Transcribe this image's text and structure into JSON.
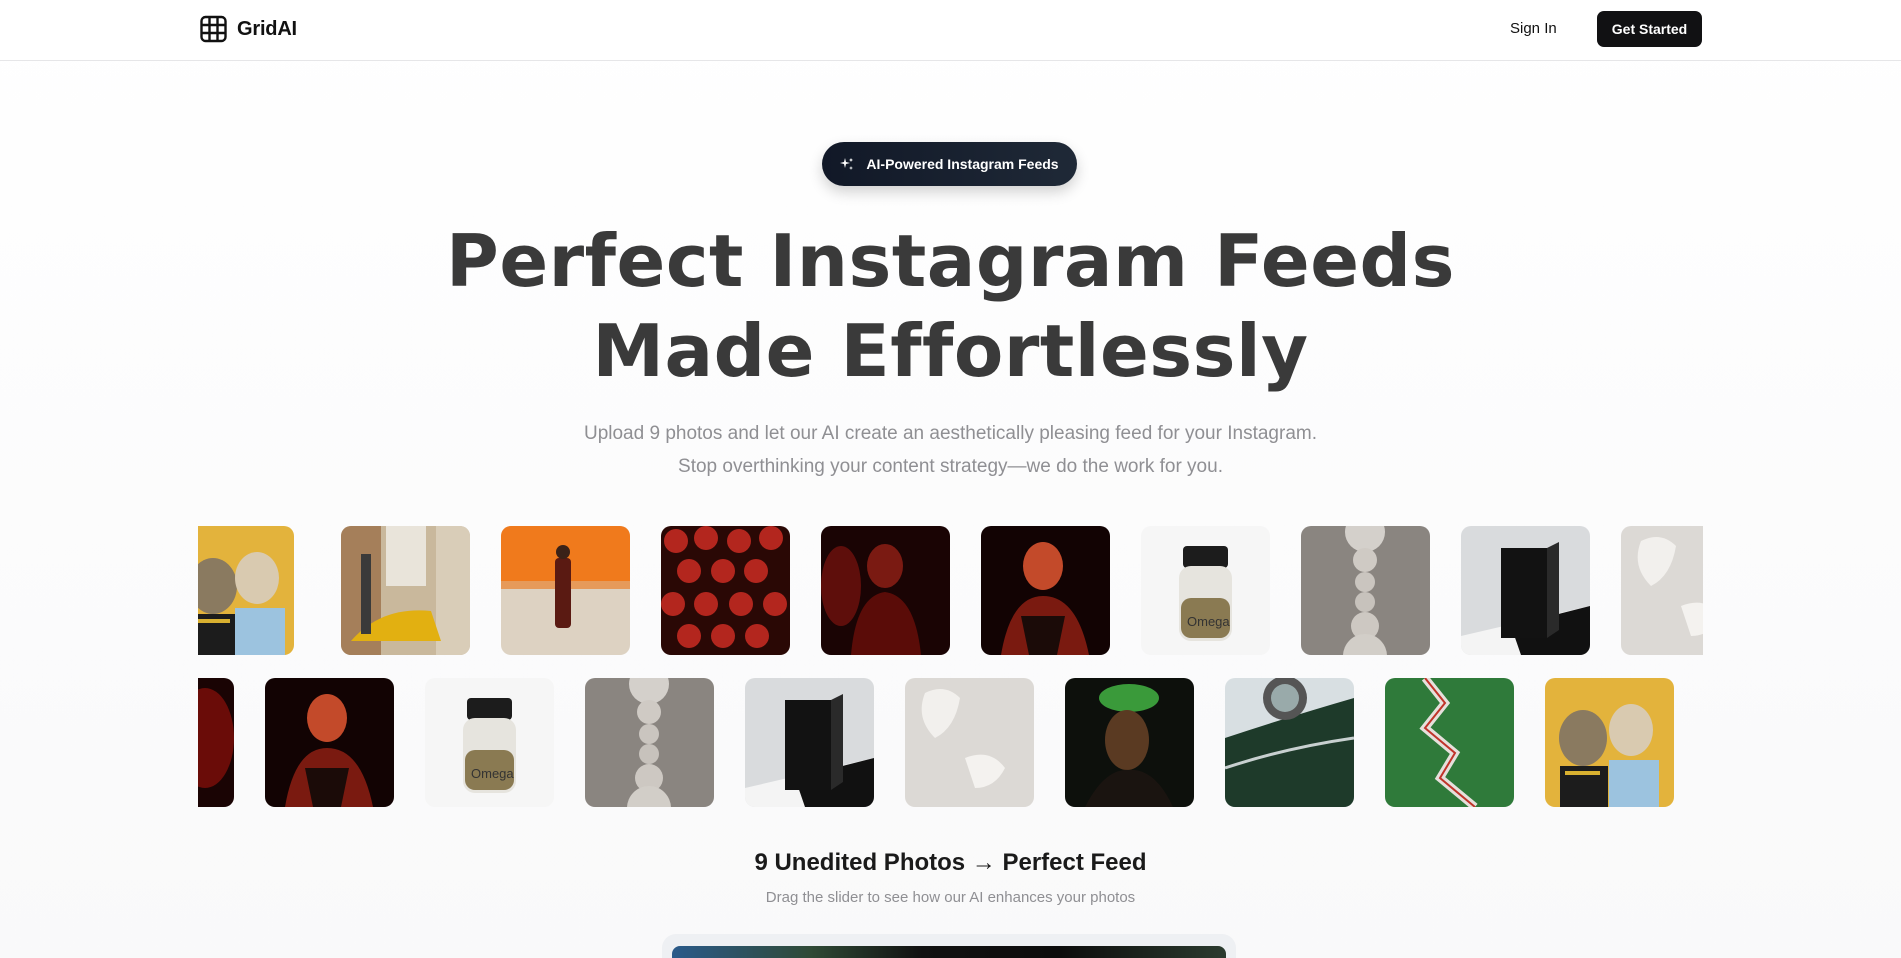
{
  "nav": {
    "brand": "GridAI",
    "sign_in": "Sign In",
    "cta": "Get Started",
    "logo_icon": "grid-icon"
  },
  "hero": {
    "badge": "AI-Powered Instagram Feeds",
    "badge_icon": "sparkle-icon",
    "headline_line1": "Perfect Instagram Feeds",
    "headline_line2": "Made Effortlessly",
    "subtitle_line1": "Upload 9 photos and let our AI create an aesthetically pleasing feed for your Instagram.",
    "subtitle_line2": "Stop overthinking your content strategy—we do the work for you."
  },
  "gallery": {
    "row1": [
      "dogs-yellow",
      "yellow-car-street",
      "man-orange-wall",
      "red-ornaments",
      "woman-red-dark",
      "woman-red-portrait",
      "omega-bottle",
      "stone-sculpture",
      "black-cube",
      "white-sculpture"
    ],
    "row2": [
      "woman-red-dark",
      "woman-red-portrait",
      "omega-bottle",
      "stone-sculpture",
      "black-cube",
      "white-sculpture",
      "green-blur-portrait",
      "green-car-detail",
      "green-zigzag",
      "dogs-yellow"
    ]
  },
  "section": {
    "title": "9 Unedited Photos → Perfect Feed",
    "subtitle": "Drag the slider to see how our AI enhances your photos"
  },
  "colors": {
    "primary": "#111113",
    "badge_bg": "#111827",
    "heading": "#3a3a3a",
    "muted": "#8f8f93"
  }
}
